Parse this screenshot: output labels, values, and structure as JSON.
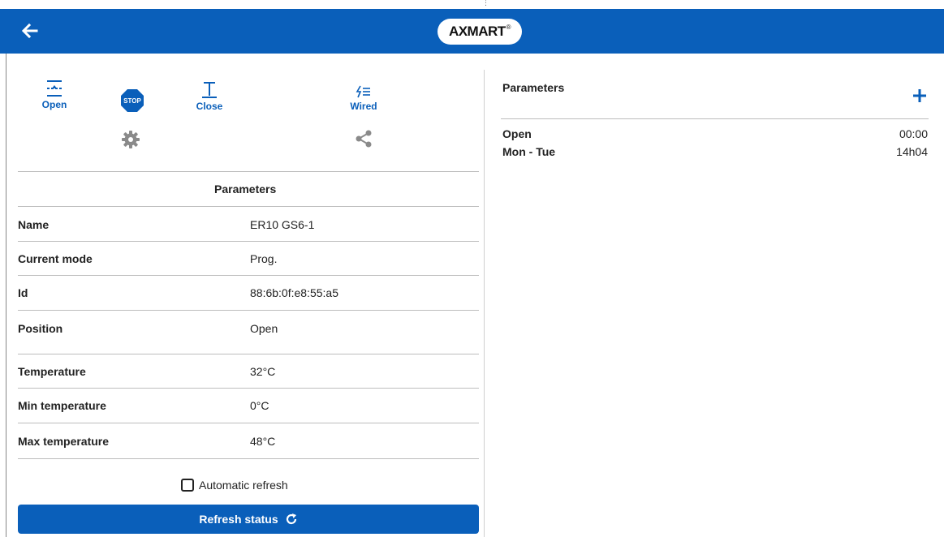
{
  "header": {
    "logo_text": "AXMART",
    "logo_mark": "®",
    "brand_color": "#0a5fba",
    "back_icon": "arrow-left-icon"
  },
  "controls": {
    "open_label": "Open",
    "stop_label": "STOP",
    "close_label": "Close",
    "wired_label": "Wired",
    "settings_icon": "gear-icon",
    "share_icon": "share-icon"
  },
  "parameters": {
    "title": "Parameters",
    "rows": [
      {
        "key": "Name",
        "value": "ER10 GS6-1"
      },
      {
        "key": "Current mode",
        "value": "Prog."
      },
      {
        "key": "Id",
        "value": "88:6b:0f:e8:55:a5"
      },
      {
        "key": "Position",
        "value": "Open"
      },
      {
        "key": "Temperature",
        "value": "32°C"
      },
      {
        "key": "Min temperature",
        "value": "0°C"
      },
      {
        "key": "Max temperature",
        "value": "48°C"
      }
    ]
  },
  "auto_refresh": {
    "label": "Automatic refresh",
    "checked": false
  },
  "refresh_button": {
    "label": "Refresh status"
  },
  "right_panel": {
    "title": "Parameters",
    "add_icon": "plus-icon",
    "schedule": [
      {
        "label": "Open",
        "value": "00:00"
      },
      {
        "label": "Mon - Tue",
        "value": "14h04"
      }
    ]
  }
}
